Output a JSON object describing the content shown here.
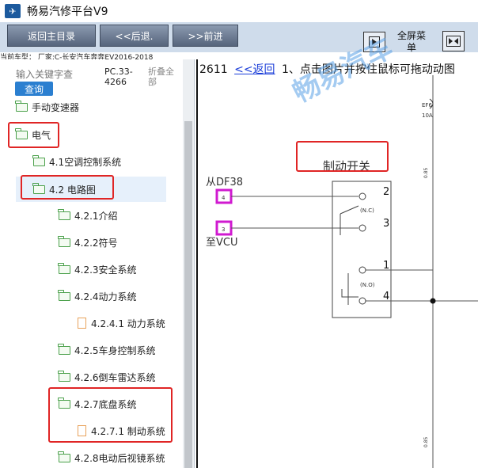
{
  "window": {
    "title": "畅易汽修平台V9",
    "logo_icon": "app-logo-icon"
  },
  "toolbar": {
    "home_label": "返回主目录",
    "back_label": "<<后退.",
    "forward_label": ">>前进",
    "fullscreen_label": "全屏菜单",
    "fullscreen_icon": "expand-icon",
    "collapse_icon": "collapse-icon"
  },
  "car_model": "当前车型： 厂家:C-长安汽车奔奔EV2016-2018",
  "search": {
    "placeholder": "输入关键字查",
    "button": "查询",
    "doc_code": "PC.33-4266",
    "collapse_all": "折叠全部"
  },
  "tree": [
    {
      "label": "手动变速器",
      "type": "folder"
    },
    {
      "label": "电气",
      "type": "folder"
    },
    {
      "label": "4.1空调控制系统",
      "type": "folder"
    },
    {
      "label": "4.2 电路图",
      "type": "folder",
      "selected": true
    },
    {
      "label": "4.2.1介绍",
      "type": "folder"
    },
    {
      "label": "4.2.2符号",
      "type": "folder"
    },
    {
      "label": "4.2.3安全系统",
      "type": "folder"
    },
    {
      "label": "4.2.4动力系统",
      "type": "folder"
    },
    {
      "label": "4.2.4.1 动力系统",
      "type": "page"
    },
    {
      "label": "4.2.5车身控制系统",
      "type": "folder"
    },
    {
      "label": "4.2.6倒车雷达系统",
      "type": "folder"
    },
    {
      "label": "4.2.7底盘系统",
      "type": "folder"
    },
    {
      "label": "4.2.7.1 制动系统",
      "type": "page"
    },
    {
      "label": "4.2.8电动后视镜系统",
      "type": "folder"
    }
  ],
  "diagram": {
    "page_number": "2611",
    "back_link": "<<返回",
    "instruction": "1、点击图片并按住鼠标可拖动动图",
    "component_label": "制动开关",
    "from_label": "从DF38",
    "to_label": "至VCU",
    "pin_top": "4",
    "pin_bottom": "3",
    "terminal_2": "2",
    "terminal_3": "3",
    "terminal_1": "1",
    "terminal_4": "4",
    "nc_label": "(N.C)",
    "no_label": "(N.O)",
    "fuse_label_1": "EF6",
    "fuse_label_2": "10A",
    "wire_label_1": "0.85",
    "wire_label_2": "0.85",
    "watermark": "畅易汽车"
  }
}
